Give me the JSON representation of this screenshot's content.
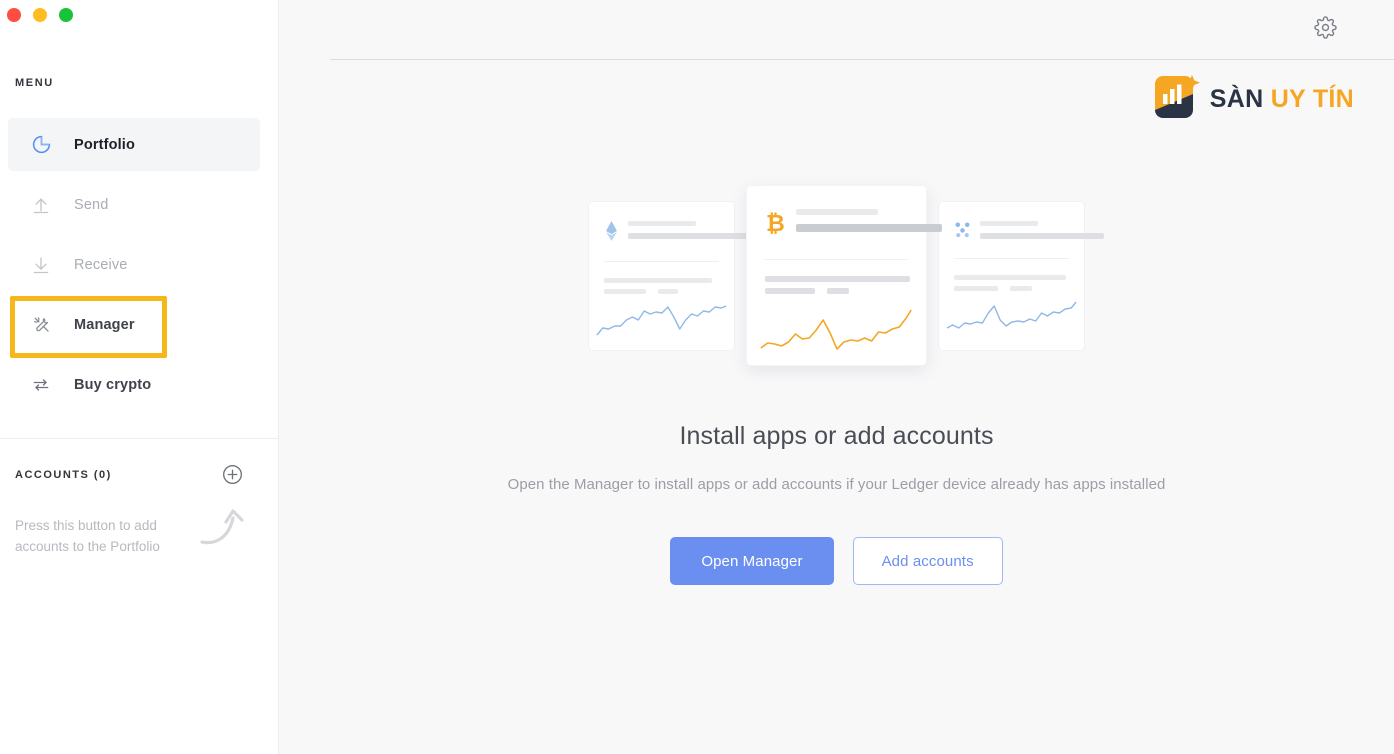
{
  "window": {
    "controls": [
      {
        "name": "close",
        "color": "#ff4d42"
      },
      {
        "name": "minimize",
        "color": "#ffbd21"
      },
      {
        "name": "zoom",
        "color": "#18c239"
      }
    ]
  },
  "sidebar": {
    "menu_label": "MENU",
    "items": [
      {
        "label": "Portfolio",
        "icon": "pie-chart-icon",
        "state": "active"
      },
      {
        "label": "Send",
        "icon": "arrow-up-icon",
        "state": "disabled"
      },
      {
        "label": "Receive",
        "icon": "arrow-down-icon",
        "state": "disabled"
      },
      {
        "label": "Manager",
        "icon": "tools-icon",
        "state": "highlighted"
      },
      {
        "label": "Buy crypto",
        "icon": "swap-icon",
        "state": "enabled"
      }
    ],
    "accounts": {
      "title": "ACCOUNTS (0)",
      "count": 0,
      "add_icon": "plus-circle-icon",
      "hint": "Press this button to add accounts to the Portfolio",
      "arrow_icon": "curved-arrow-icon"
    },
    "highlight_color": "#f5b719"
  },
  "header": {
    "settings_icon": "gear-icon",
    "brand": {
      "icon": "bar-chart-logo-icon",
      "text_primary": "SÀN",
      "text_accent": "UY TÍN",
      "primary_color": "#2b3445",
      "accent_color": "#f5a623"
    }
  },
  "main": {
    "cards": [
      {
        "icon": "ethereum-icon",
        "position": "left",
        "chart_color": "#8fb8e8"
      },
      {
        "icon": "bitcoin-icon",
        "position": "center",
        "chart_color": "#f5a623"
      },
      {
        "icon": "ripple-icon",
        "position": "right",
        "chart_color": "#8fb8e8"
      }
    ],
    "title": "Install apps or add accounts",
    "subtitle": "Open the Manager to install apps or add accounts if your Ledger device already has apps installed",
    "buttons": [
      {
        "label": "Open Manager",
        "style": "primary"
      },
      {
        "label": "Add accounts",
        "style": "ghost"
      }
    ],
    "accent_color": "#6a8ff0"
  }
}
